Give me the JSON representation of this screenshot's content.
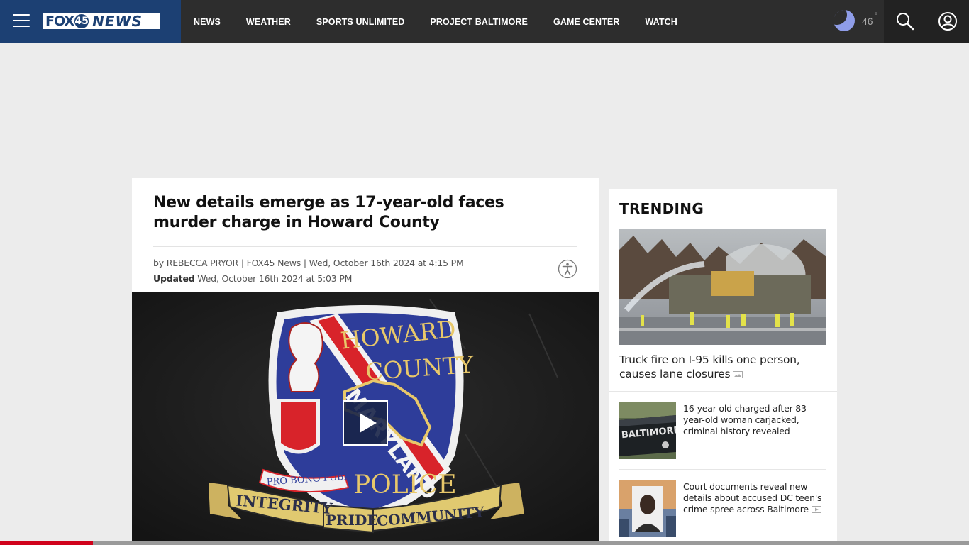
{
  "header": {
    "logo": {
      "part1": "FOX",
      "number": "45",
      "part2": "NEWS"
    },
    "nav": [
      {
        "label": "NEWS"
      },
      {
        "label": "WEATHER"
      },
      {
        "label": "SPORTS UNLIMITED"
      },
      {
        "label": "PROJECT BALTIMORE"
      },
      {
        "label": "GAME CENTER"
      },
      {
        "label": "WATCH"
      }
    ],
    "weather": {
      "temp": "46",
      "degree": "°",
      "icon": "moon-icon"
    },
    "icons": {
      "menu": "hamburger-menu-icon",
      "search": "search-icon",
      "account": "user-account-icon"
    }
  },
  "article": {
    "headline": "New details emerge as 17-year-old faces murder charge in Howard County",
    "byline": "by REBECCA PRYOR | FOX45 News | Wed, October 16th 2024 at 4:15 PM",
    "updated_label": "Updated",
    "updated_value": " Wed, October 16th 2024 at 5:03 PM",
    "accessibility_icon": "accessibility-icon",
    "video": {
      "badge_top_left": "HOWARD",
      "badge_top_right": "COUNTY",
      "sash": "MARYLAND",
      "bottom_word": "POLICE",
      "motto": "PRO BONO PUBLICO",
      "ribbon": [
        "INTEGRITY",
        "PRIDE",
        "COMMUNITY"
      ],
      "play_icon": "play-icon"
    }
  },
  "trending": {
    "title": "TRENDING",
    "items": [
      {
        "text": "Truck fire on I-95 kills one person, causes lane closures",
        "media_icon": "gallery-icon"
      },
      {
        "text": "16-year-old charged after 83-year-old woman carjacked, criminal history revealed",
        "thumb_text": "BALTIMORE"
      },
      {
        "text": "Court documents reveal new details about accused DC teen's crime spree across Baltimore",
        "media_icon": "video-icon"
      }
    ]
  },
  "colors": {
    "brand": "#1c4073",
    "header": "#2d2d2d",
    "progress": "#d0021b"
  },
  "progress": {
    "fraction": 0.096
  }
}
